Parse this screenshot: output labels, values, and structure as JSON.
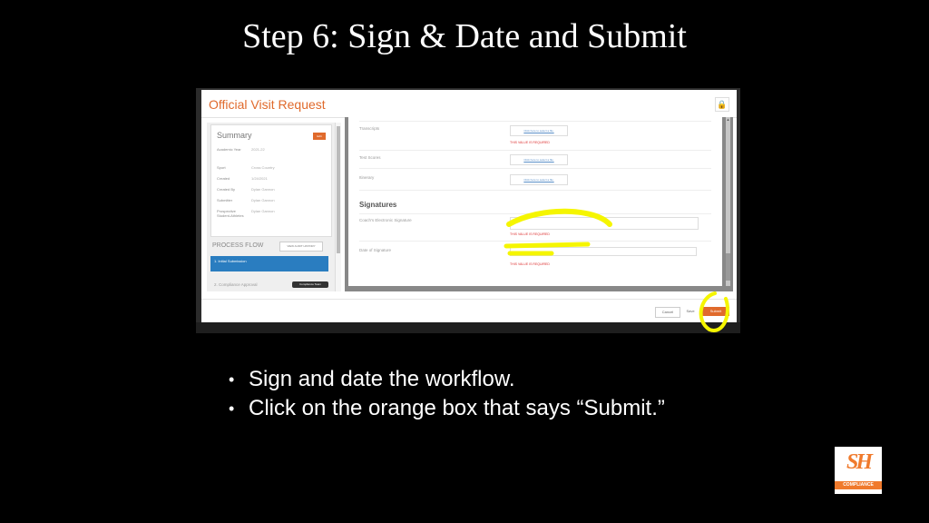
{
  "slide": {
    "title": "Step 6: Sign & Date and Submit",
    "bullets": [
      "Sign and date the workflow.",
      "Click on the orange box that says “Submit.”"
    ]
  },
  "modal": {
    "title": "Official Visit Request",
    "lock_icon": "lock-icon",
    "summary": {
      "title": "Summary",
      "edit_label": "Edit",
      "rows": [
        {
          "key": "Academic Year",
          "value": "2021-22"
        },
        {
          "key": "Sport",
          "value": "Cross Country"
        },
        {
          "key": "Created",
          "value": "1/24/2021"
        },
        {
          "key": "Created By",
          "value": "Dylan Gannon"
        },
        {
          "key": "Submitter",
          "value": "Dylan Gannon"
        },
        {
          "key": "Prospective Student-Athletes",
          "value": "Dylan Gannon"
        }
      ]
    },
    "process_flow": {
      "title": "PROCESS FLOW",
      "history_button": "VIEW AUDIT HISTORY",
      "steps": [
        {
          "label": "1. Initial Submission"
        },
        {
          "label": "2. Compliance Approval",
          "badge": "Compliance Team"
        }
      ]
    },
    "form": {
      "fields": [
        {
          "label": "Transcripts",
          "link": "Click here to select a file.",
          "required": "THIS VALUE IS REQUIRED"
        },
        {
          "label": "Test Scores",
          "link": "Click here to select a file."
        },
        {
          "label": "Itinerary",
          "link": "Click here to select a file."
        }
      ],
      "signatures": {
        "title": "Signatures",
        "signature_label": "Coach's Electronic Signature",
        "signature_required": "THIS VALUE IS REQUIRED",
        "date_label": "Date of Signature",
        "date_placeholder": "mm/dd/yyyy",
        "date_required": "THIS VALUE IS REQUIRED"
      }
    },
    "footer": {
      "cancel": "Cancel",
      "save": "Save",
      "submit": "Submit"
    },
    "accent_color": "#e06a2c",
    "highlight_color": "#f5f500"
  },
  "logo": {
    "mark": "SH",
    "text": "COMPLIANCE",
    "color": "#f07a2c"
  }
}
